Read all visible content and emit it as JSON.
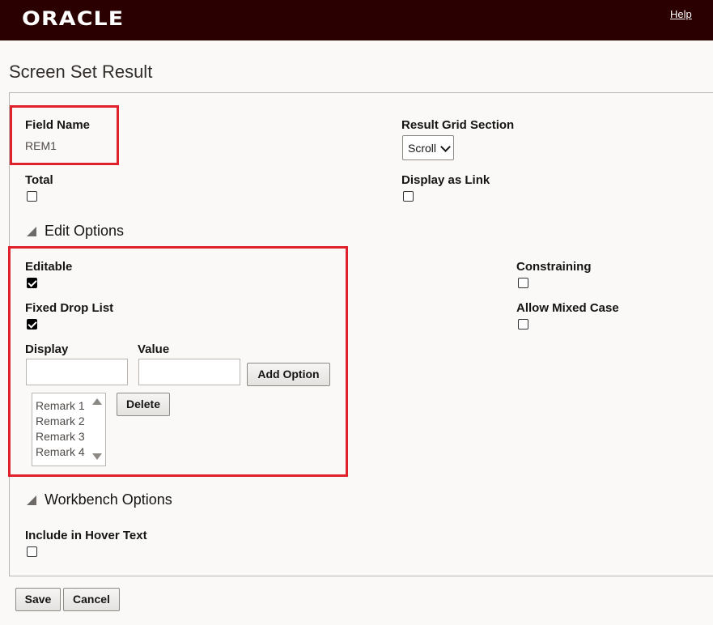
{
  "header": {
    "logo": "ORACLE",
    "help_label": "Help"
  },
  "page": {
    "title": "Screen Set Result"
  },
  "field_name": {
    "label": "Field Name",
    "value": "REM1"
  },
  "result_grid_section": {
    "label": "Result Grid Section",
    "selected": "Scroll"
  },
  "total": {
    "label": "Total",
    "checked": false
  },
  "display_as_link": {
    "label": "Display as Link",
    "checked": false
  },
  "edit_options": {
    "heading": "Edit Options",
    "editable": {
      "label": "Editable",
      "checked": true
    },
    "fixed_drop_list": {
      "label": "Fixed Drop List",
      "checked": true
    },
    "constraining": {
      "label": "Constraining",
      "checked": false
    },
    "allow_mixed_case": {
      "label": "Allow Mixed Case",
      "checked": false
    },
    "display_label": "Display",
    "value_label": "Value",
    "display_input": "",
    "value_input": "",
    "add_option_label": "Add Option",
    "delete_label": "Delete",
    "options": [
      "Remark 1",
      "Remark 2",
      "Remark 3",
      "Remark 4"
    ]
  },
  "workbench_options": {
    "heading": "Workbench Options",
    "include_in_hover_text": {
      "label": "Include in Hover Text",
      "checked": false
    }
  },
  "footer": {
    "save_label": "Save",
    "cancel_label": "Cancel"
  },
  "colors": {
    "header_bg": "#2b0000",
    "highlight": "#e0202a"
  },
  "icons": {
    "collapse": "triangle-expanded-icon",
    "select": "chevron-down-icon"
  }
}
